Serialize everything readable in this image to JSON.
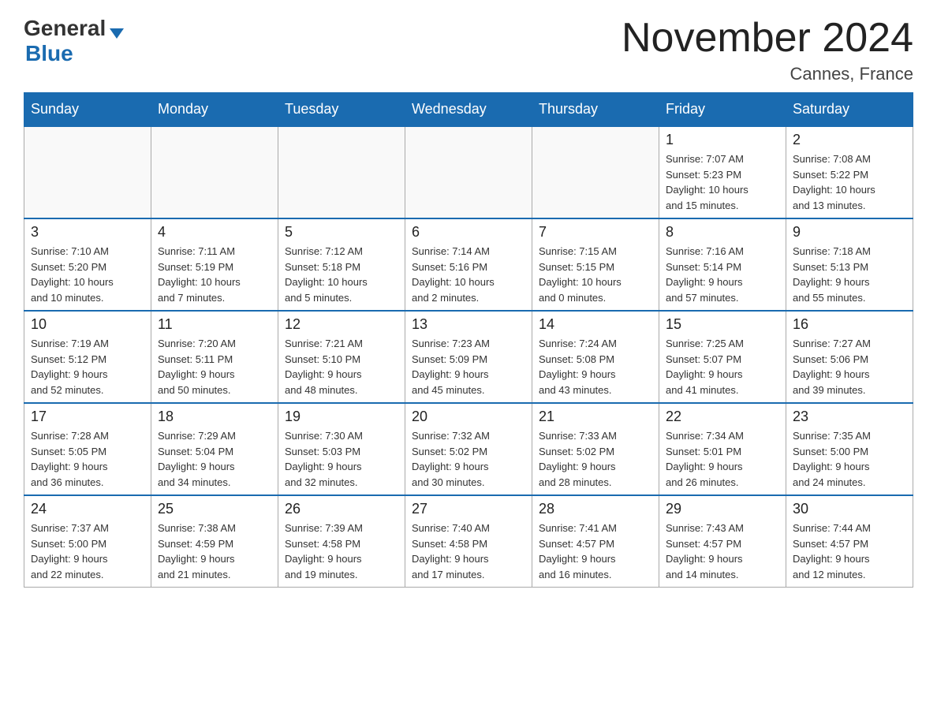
{
  "header": {
    "logo": {
      "general_text": "General",
      "blue_text": "Blue"
    },
    "month_title": "November 2024",
    "location": "Cannes, France"
  },
  "weekdays": [
    "Sunday",
    "Monday",
    "Tuesday",
    "Wednesday",
    "Thursday",
    "Friday",
    "Saturday"
  ],
  "weeks": [
    [
      {
        "day": "",
        "info": ""
      },
      {
        "day": "",
        "info": ""
      },
      {
        "day": "",
        "info": ""
      },
      {
        "day": "",
        "info": ""
      },
      {
        "day": "",
        "info": ""
      },
      {
        "day": "1",
        "info": "Sunrise: 7:07 AM\nSunset: 5:23 PM\nDaylight: 10 hours\nand 15 minutes."
      },
      {
        "day": "2",
        "info": "Sunrise: 7:08 AM\nSunset: 5:22 PM\nDaylight: 10 hours\nand 13 minutes."
      }
    ],
    [
      {
        "day": "3",
        "info": "Sunrise: 7:10 AM\nSunset: 5:20 PM\nDaylight: 10 hours\nand 10 minutes."
      },
      {
        "day": "4",
        "info": "Sunrise: 7:11 AM\nSunset: 5:19 PM\nDaylight: 10 hours\nand 7 minutes."
      },
      {
        "day": "5",
        "info": "Sunrise: 7:12 AM\nSunset: 5:18 PM\nDaylight: 10 hours\nand 5 minutes."
      },
      {
        "day": "6",
        "info": "Sunrise: 7:14 AM\nSunset: 5:16 PM\nDaylight: 10 hours\nand 2 minutes."
      },
      {
        "day": "7",
        "info": "Sunrise: 7:15 AM\nSunset: 5:15 PM\nDaylight: 10 hours\nand 0 minutes."
      },
      {
        "day": "8",
        "info": "Sunrise: 7:16 AM\nSunset: 5:14 PM\nDaylight: 9 hours\nand 57 minutes."
      },
      {
        "day": "9",
        "info": "Sunrise: 7:18 AM\nSunset: 5:13 PM\nDaylight: 9 hours\nand 55 minutes."
      }
    ],
    [
      {
        "day": "10",
        "info": "Sunrise: 7:19 AM\nSunset: 5:12 PM\nDaylight: 9 hours\nand 52 minutes."
      },
      {
        "day": "11",
        "info": "Sunrise: 7:20 AM\nSunset: 5:11 PM\nDaylight: 9 hours\nand 50 minutes."
      },
      {
        "day": "12",
        "info": "Sunrise: 7:21 AM\nSunset: 5:10 PM\nDaylight: 9 hours\nand 48 minutes."
      },
      {
        "day": "13",
        "info": "Sunrise: 7:23 AM\nSunset: 5:09 PM\nDaylight: 9 hours\nand 45 minutes."
      },
      {
        "day": "14",
        "info": "Sunrise: 7:24 AM\nSunset: 5:08 PM\nDaylight: 9 hours\nand 43 minutes."
      },
      {
        "day": "15",
        "info": "Sunrise: 7:25 AM\nSunset: 5:07 PM\nDaylight: 9 hours\nand 41 minutes."
      },
      {
        "day": "16",
        "info": "Sunrise: 7:27 AM\nSunset: 5:06 PM\nDaylight: 9 hours\nand 39 minutes."
      }
    ],
    [
      {
        "day": "17",
        "info": "Sunrise: 7:28 AM\nSunset: 5:05 PM\nDaylight: 9 hours\nand 36 minutes."
      },
      {
        "day": "18",
        "info": "Sunrise: 7:29 AM\nSunset: 5:04 PM\nDaylight: 9 hours\nand 34 minutes."
      },
      {
        "day": "19",
        "info": "Sunrise: 7:30 AM\nSunset: 5:03 PM\nDaylight: 9 hours\nand 32 minutes."
      },
      {
        "day": "20",
        "info": "Sunrise: 7:32 AM\nSunset: 5:02 PM\nDaylight: 9 hours\nand 30 minutes."
      },
      {
        "day": "21",
        "info": "Sunrise: 7:33 AM\nSunset: 5:02 PM\nDaylight: 9 hours\nand 28 minutes."
      },
      {
        "day": "22",
        "info": "Sunrise: 7:34 AM\nSunset: 5:01 PM\nDaylight: 9 hours\nand 26 minutes."
      },
      {
        "day": "23",
        "info": "Sunrise: 7:35 AM\nSunset: 5:00 PM\nDaylight: 9 hours\nand 24 minutes."
      }
    ],
    [
      {
        "day": "24",
        "info": "Sunrise: 7:37 AM\nSunset: 5:00 PM\nDaylight: 9 hours\nand 22 minutes."
      },
      {
        "day": "25",
        "info": "Sunrise: 7:38 AM\nSunset: 4:59 PM\nDaylight: 9 hours\nand 21 minutes."
      },
      {
        "day": "26",
        "info": "Sunrise: 7:39 AM\nSunset: 4:58 PM\nDaylight: 9 hours\nand 19 minutes."
      },
      {
        "day": "27",
        "info": "Sunrise: 7:40 AM\nSunset: 4:58 PM\nDaylight: 9 hours\nand 17 minutes."
      },
      {
        "day": "28",
        "info": "Sunrise: 7:41 AM\nSunset: 4:57 PM\nDaylight: 9 hours\nand 16 minutes."
      },
      {
        "day": "29",
        "info": "Sunrise: 7:43 AM\nSunset: 4:57 PM\nDaylight: 9 hours\nand 14 minutes."
      },
      {
        "day": "30",
        "info": "Sunrise: 7:44 AM\nSunset: 4:57 PM\nDaylight: 9 hours\nand 12 minutes."
      }
    ]
  ]
}
